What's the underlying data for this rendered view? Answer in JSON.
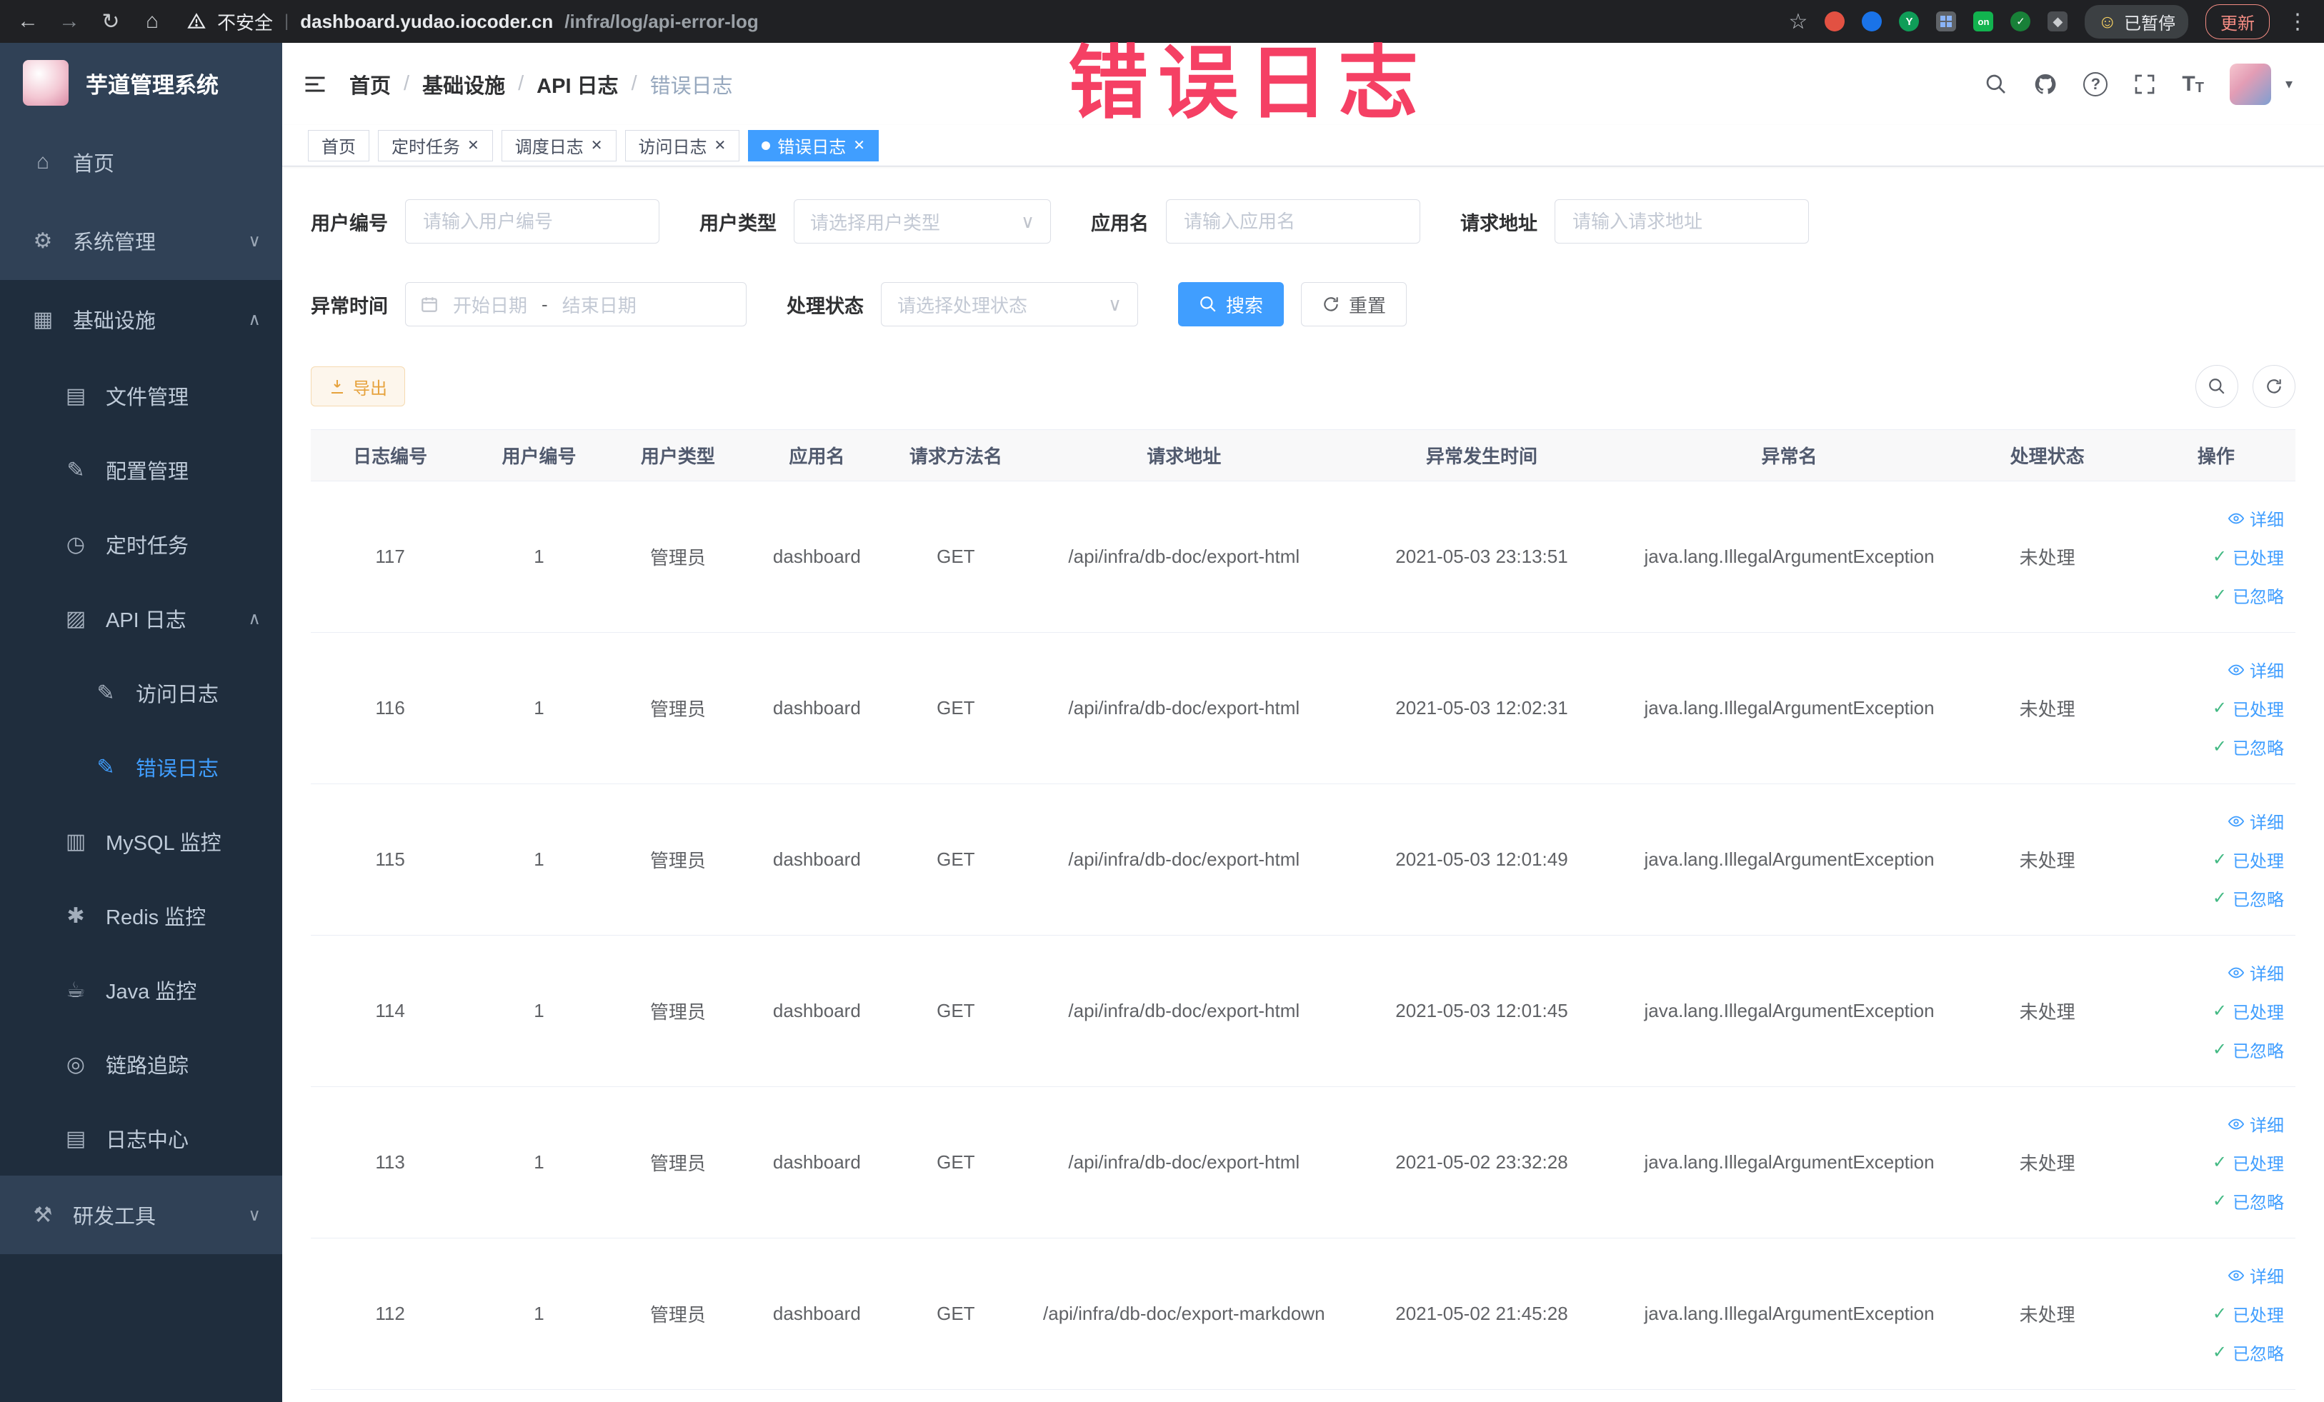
{
  "annotation": {
    "text": "错误日志"
  },
  "browser": {
    "not_secure": "不安全",
    "url_domain": "dashboard.yudao.iocoder.cn",
    "url_path": "/infra/log/api-error-log",
    "paused_badge": "已暂停",
    "update_button": "更新"
  },
  "sidebar": {
    "logo_title": "芋道管理系统",
    "menu": [
      {
        "label": "首页"
      },
      {
        "label": "系统管理"
      },
      {
        "label": "基础设施"
      },
      {
        "label": "文件管理"
      },
      {
        "label": "配置管理"
      },
      {
        "label": "定时任务"
      },
      {
        "label": "API 日志"
      },
      {
        "label": "访问日志"
      },
      {
        "label": "错误日志"
      },
      {
        "label": "MySQL 监控"
      },
      {
        "label": "Redis 监控"
      },
      {
        "label": "Java 监控"
      },
      {
        "label": "链路追踪"
      },
      {
        "label": "日志中心"
      },
      {
        "label": "研发工具"
      }
    ]
  },
  "header": {
    "breadcrumb": [
      "首页",
      "基础设施",
      "API 日志",
      "错误日志"
    ]
  },
  "tabs": [
    {
      "label": "首页"
    },
    {
      "label": "定时任务"
    },
    {
      "label": "调度日志"
    },
    {
      "label": "访问日志"
    },
    {
      "label": "错误日志"
    }
  ],
  "filters": {
    "user_id": {
      "label": "用户编号",
      "placeholder": "请输入用户编号"
    },
    "user_type": {
      "label": "用户类型",
      "placeholder": "请选择用户类型"
    },
    "app_name": {
      "label": "应用名",
      "placeholder": "请输入应用名"
    },
    "request_url": {
      "label": "请求地址",
      "placeholder": "请输入请求地址"
    },
    "exception_time": {
      "label": "异常时间",
      "start_placeholder": "开始日期",
      "separator": "-",
      "end_placeholder": "结束日期"
    },
    "process_status": {
      "label": "处理状态",
      "placeholder": "请选择处理状态"
    },
    "search_button": "搜索",
    "reset_button": "重置"
  },
  "toolbar": {
    "export_button": "导出"
  },
  "table": {
    "columns": [
      "日志编号",
      "用户编号",
      "用户类型",
      "应用名",
      "请求方法名",
      "请求地址",
      "异常发生时间",
      "异常名",
      "处理状态",
      "操作"
    ],
    "actions": {
      "detail": "详细",
      "processed": "已处理",
      "ignore": "已忽略"
    },
    "rows": [
      {
        "id": "117",
        "user_id": "1",
        "user_type": "管理员",
        "app": "dashboard",
        "method": "GET",
        "url": "/api/infra/db-doc/export-html",
        "time": "2021-05-03 23:13:51",
        "exception": "java.lang.IllegalArgumentException",
        "status": "未处理"
      },
      {
        "id": "116",
        "user_id": "1",
        "user_type": "管理员",
        "app": "dashboard",
        "method": "GET",
        "url": "/api/infra/db-doc/export-html",
        "time": "2021-05-03 12:02:31",
        "exception": "java.lang.IllegalArgumentException",
        "status": "未处理"
      },
      {
        "id": "115",
        "user_id": "1",
        "user_type": "管理员",
        "app": "dashboard",
        "method": "GET",
        "url": "/api/infra/db-doc/export-html",
        "time": "2021-05-03 12:01:49",
        "exception": "java.lang.IllegalArgumentException",
        "status": "未处理"
      },
      {
        "id": "114",
        "user_id": "1",
        "user_type": "管理员",
        "app": "dashboard",
        "method": "GET",
        "url": "/api/infra/db-doc/export-html",
        "time": "2021-05-03 12:01:45",
        "exception": "java.lang.IllegalArgumentException",
        "status": "未处理"
      },
      {
        "id": "113",
        "user_id": "1",
        "user_type": "管理员",
        "app": "dashboard",
        "method": "GET",
        "url": "/api/infra/db-doc/export-html",
        "time": "2021-05-02 23:32:28",
        "exception": "java.lang.IllegalArgumentException",
        "status": "未处理"
      },
      {
        "id": "112",
        "user_id": "1",
        "user_type": "管理员",
        "app": "dashboard",
        "method": "GET",
        "url": "/api/infra/db-doc/export-markdown",
        "time": "2021-05-02 21:45:28",
        "exception": "java.lang.IllegalArgumentException",
        "status": "未处理"
      }
    ]
  }
}
